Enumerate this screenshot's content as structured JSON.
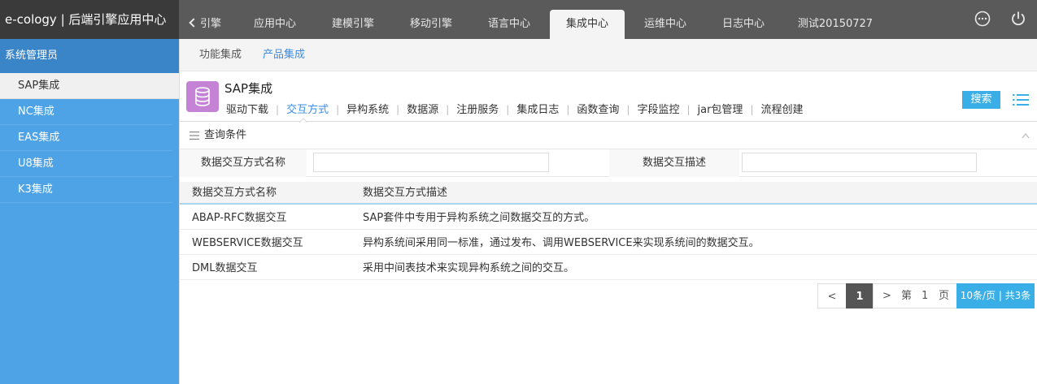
{
  "app": {
    "title": "e-cology | 后端引擎应用中心"
  },
  "nav": {
    "back_label": "引擎",
    "tabs": [
      {
        "label": "应用中心"
      },
      {
        "label": "建模引擎"
      },
      {
        "label": "移动引擎"
      },
      {
        "label": "语言中心"
      },
      {
        "label": "集成中心"
      },
      {
        "label": "运维中心"
      },
      {
        "label": "日志中心"
      },
      {
        "label": "测试20150727"
      }
    ],
    "active_tab": "集成中心",
    "icons": [
      "more-icon",
      "power-icon"
    ]
  },
  "sidebar": {
    "header": "系统管理员",
    "items": [
      {
        "label": "SAP集成"
      },
      {
        "label": "NC集成"
      },
      {
        "label": "EAS集成"
      },
      {
        "label": "U8集成"
      },
      {
        "label": "K3集成"
      }
    ],
    "active_item": "SAP集成"
  },
  "subtabs": {
    "items": [
      {
        "label": "功能集成"
      },
      {
        "label": "产品集成"
      }
    ],
    "active": "产品集成"
  },
  "page": {
    "title": "SAP集成",
    "icon": "database-icon",
    "menu": [
      {
        "label": "驱动下载"
      },
      {
        "label": "交互方式"
      },
      {
        "label": "异构系统"
      },
      {
        "label": "数据源"
      },
      {
        "label": "注册服务"
      },
      {
        "label": "集成日志"
      },
      {
        "label": "函数查询"
      },
      {
        "label": "字段监控"
      },
      {
        "label": "jar包管理"
      },
      {
        "label": "流程创建"
      }
    ],
    "active_menu": "交互方式",
    "search_label": "搜索"
  },
  "conditions": {
    "title": "查询条件",
    "fields": [
      {
        "label": "数据交互方式名称",
        "value": ""
      },
      {
        "label": "数据交互描述",
        "value": ""
      }
    ]
  },
  "table": {
    "columns": [
      "数据交互方式名称",
      "数据交互方式描述"
    ],
    "rows": [
      [
        "ABAP-RFC数据交互",
        "SAP套件中专用于异构系统之间数据交互的方式。"
      ],
      [
        "WEBSERVICE数据交互",
        "异构系统间采用同一标准，通过发布、调用WEBSERVICE来实现系统间的数据交互。"
      ],
      [
        "DML数据交互",
        "采用中间表技术来实现异构系统之间的交互。"
      ]
    ]
  },
  "pager": {
    "prev": "<",
    "current": "1",
    "next": ">",
    "di": "第",
    "page_num": "1",
    "ye": "页",
    "info": "10条/页 | 共3条"
  },
  "colors": {
    "accent": "#3a8ee6",
    "sidebar": "#4ea2e6",
    "topbar": "#5a5a5a",
    "app_icon": "#c583d6"
  }
}
